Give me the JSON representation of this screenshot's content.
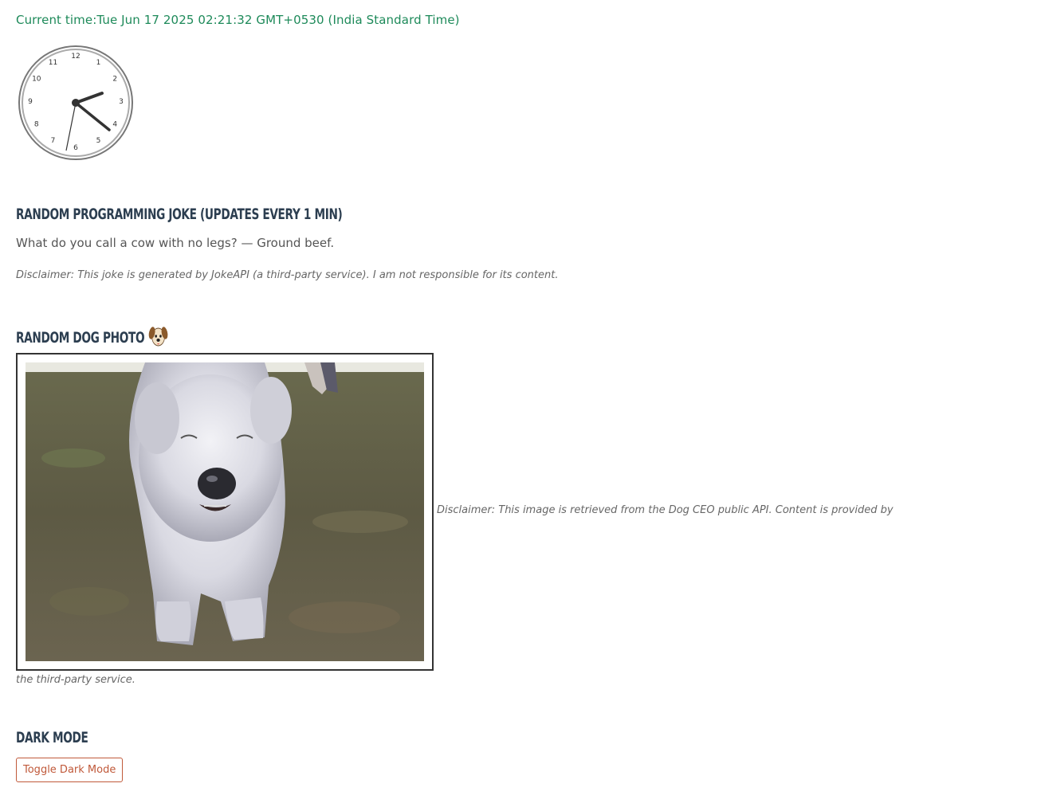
{
  "time": {
    "label": "Current time:",
    "value": "Tue Jun 17 2025 02:21:32 GMT+0530 (India Standard Time)"
  },
  "clock": {
    "numbers": [
      "12",
      "1",
      "2",
      "3",
      "4",
      "5",
      "6",
      "7",
      "8",
      "9",
      "10",
      "11"
    ]
  },
  "joke": {
    "heading": "Random Programming Joke (Updates every 1 min)",
    "text": "What do you call a cow with no legs? — Ground beef.",
    "disclaimer": "Disclaimer: This joke is generated by JokeAPI (a third-party service). I am not responsible for its content."
  },
  "dog": {
    "heading": "Random Dog Photo",
    "heading_icon": "dog-face-emoji",
    "disclaimer_part1": "Disclaimer: This image is retrieved from the Dog CEO public API. Content is provided by",
    "disclaimer_part2": "the third-party service."
  },
  "dark_mode": {
    "heading": "Dark Mode",
    "button_label": "Toggle Dark Mode",
    "accent": "#c0593a"
  },
  "colors": {
    "time_text": "#1e8a5a",
    "heading": "#2c3e50"
  }
}
